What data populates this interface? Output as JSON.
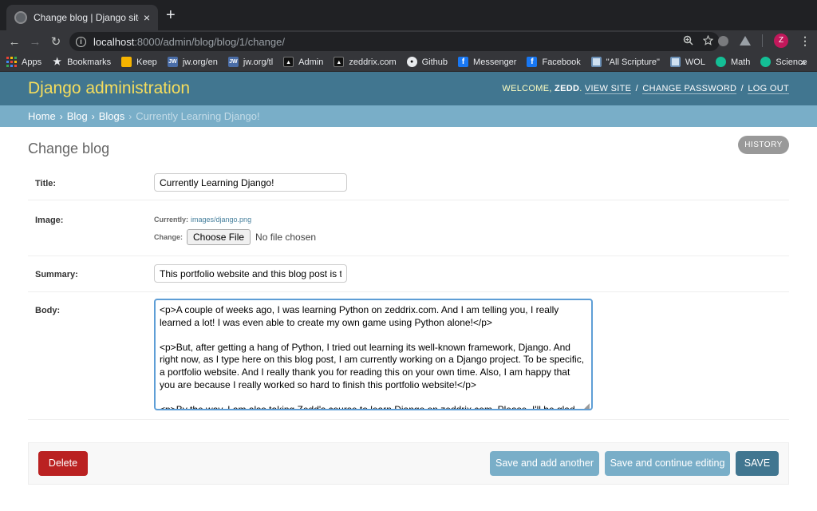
{
  "browser": {
    "tab_title": "Change blog | Django site admin",
    "tab_close": "×",
    "new_tab": "+",
    "url_host": "localhost",
    "url_rest": ":8000/admin/blog/blog/1/change/",
    "profile_initial": "Z",
    "bookmarks": [
      {
        "label": "Apps",
        "icon": "apps-grid-icon",
        "color": "#ea4335"
      },
      {
        "label": "Bookmarks",
        "icon": "star-icon",
        "color": "#e8eaed"
      },
      {
        "label": "Keep",
        "icon": "keep-icon",
        "color": "#f6b400"
      },
      {
        "label": "jw.org/en",
        "icon": "jw-icon",
        "color": "#4a6da7"
      },
      {
        "label": "jw.org/tl",
        "icon": "jw-icon",
        "color": "#4a6da7"
      },
      {
        "label": "Admin",
        "icon": "admin-icon",
        "color": "#111111"
      },
      {
        "label": "zeddrix.com",
        "icon": "zeddrix-icon",
        "color": "#111111"
      },
      {
        "label": "Github",
        "icon": "github-icon",
        "color": "#111111"
      },
      {
        "label": "Messenger",
        "icon": "facebook-icon",
        "color": "#1877f2"
      },
      {
        "label": "Facebook",
        "icon": "facebook-icon",
        "color": "#1877f2"
      },
      {
        "label": "\"All Scripture\"",
        "icon": "book-icon",
        "color": "#6b8fb5"
      },
      {
        "label": "WOL",
        "icon": "book-icon",
        "color": "#6b8fb5"
      },
      {
        "label": "Math",
        "icon": "khan-icon",
        "color": "#14bf96"
      },
      {
        "label": "Science",
        "icon": "khan-icon",
        "color": "#14bf96"
      }
    ],
    "bookmarks_more": "»"
  },
  "admin": {
    "site_title": "Django administration",
    "welcome_prefix": "WELCOME, ",
    "username": "ZEDD",
    "view_site": "VIEW SITE",
    "change_password": "CHANGE PASSWORD",
    "log_out": "LOG OUT",
    "breadcrumbs": {
      "home": "Home",
      "app": "Blog",
      "model": "Blogs",
      "current": "Currently Learning Django!"
    },
    "page_title": "Change blog",
    "history": "HISTORY",
    "form": {
      "title_label": "Title:",
      "title_value": "Currently Learning Django!",
      "image_label": "Image:",
      "currently_label": "Currently:",
      "currently_value": "images/django.png",
      "change_label": "Change:",
      "choose_file": "Choose File",
      "no_file": "No file chosen",
      "summary_label": "Summary:",
      "summary_value": "This portfolio website and this blog post is th",
      "body_label": "Body:",
      "body_value": "<p>A couple of weeks ago, I was learning Python on zeddrix.com. And I am telling you, I really learned a lot! I was even able to create my own game using Python alone!</p>\n\n<p>But, after getting a hang of Python, I tried out learning its well-known framework, Django. And right now, as I type here on this blog post, I am currently working on a Django project. To be specific, a portfolio website. And I really thank you for reading this on your own time. Also, I am happy that you are because I really worked so hard to finish this portfolio website!</p>\n\n<p>By the way, I am also taking Zedd's course to learn Django on zeddrix.com. Please, I'll be glad for you to read all my other blog posts. I really hope you like this portfolio website! And again, thank you!</p>"
    },
    "buttons": {
      "delete": "Delete",
      "save_add_another": "Save and add another",
      "save_continue": "Save and continue editing",
      "save": "SAVE"
    },
    "colors": {
      "header": "#417690",
      "branding": "#f5dd5d",
      "breadcrumbs": "#79aec8",
      "delete": "#ba2121"
    }
  }
}
